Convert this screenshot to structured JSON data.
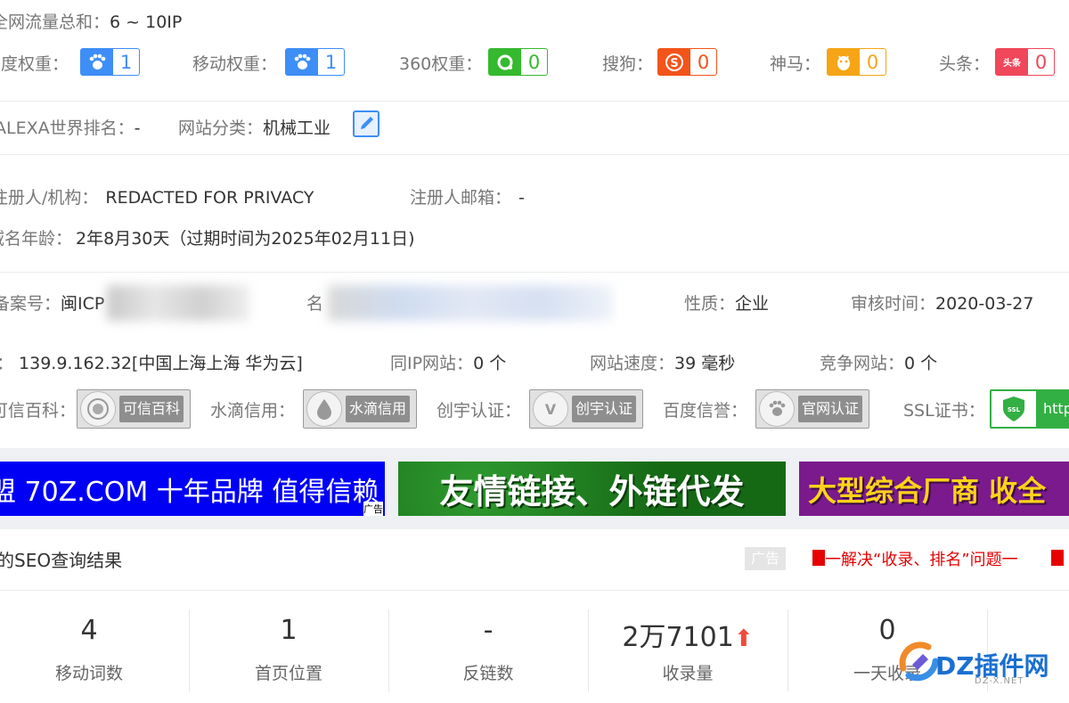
{
  "row1": {
    "label": "全网流量总和：",
    "value": "6 ~ 10IP"
  },
  "weights": [
    {
      "label": "百度权重：",
      "value": "1",
      "color": "#3e8ef7",
      "icon": "baidu-paw-icon"
    },
    {
      "label": "移动权重：",
      "value": "1",
      "color": "#3e8ef7",
      "icon": "baidu-mobile-icon"
    },
    {
      "label": "360权重：",
      "value": "0",
      "color": "#35b92f",
      "icon": "360-icon"
    },
    {
      "label": "搜狗：",
      "value": "0",
      "color": "#f2541b",
      "icon": "sogou-icon"
    },
    {
      "label": "神马：",
      "value": "0",
      "color": "#f5a516",
      "icon": "shenma-icon"
    },
    {
      "label": "头条：",
      "value": "0",
      "color": "#f0475a",
      "icon": "toutiao-icon",
      "icon_text": "头条"
    }
  ],
  "row3": {
    "alexa_label": "ALEXA世界排名：",
    "alexa_value": "-",
    "category_label": "网站分类：",
    "category_value": "机械工业"
  },
  "row4": {
    "registrant_label": "注册人/机构：",
    "registrant_value": "REDACTED FOR PRIVACY",
    "email_label": "注册人邮箱：",
    "email_value": "-"
  },
  "row5": {
    "age_label": "域名年龄：",
    "age_value": "2年8月30天（过期时间为2025年02月11日)"
  },
  "row6": {
    "icp_label": "备案号：",
    "icp_value": "闽ICP",
    "name_label": "名",
    "nature_label": "性质：",
    "nature_value": "企业",
    "audit_label": "审核时间：",
    "audit_value": "2020-03-27"
  },
  "row7": {
    "ip_label": "：",
    "ip_value": "139.9.162.32[中国上海上海 华为云]",
    "sameip_label": "同IP网站：",
    "sameip_value": "0 个",
    "speed_label": "网站速度：",
    "speed_value": "39 毫秒",
    "compete_label": "竞争网站：",
    "compete_value": "0 个"
  },
  "certs": [
    {
      "label": "可信百科：",
      "badge": "可信百科",
      "icon": "kexin-seal-icon"
    },
    {
      "label": "水滴信用：",
      "badge": "水滴信用",
      "icon": "water-drop-icon"
    },
    {
      "label": "创宇认证：",
      "badge": "创宇认证",
      "icon": "chuangyu-v-icon"
    },
    {
      "label": "百度信誉：",
      "badge": "官网认证",
      "icon": "baidu-paw-icon"
    },
    {
      "label": "SSL证书：",
      "badge": "http",
      "icon": "ssl-shield-icon"
    }
  ],
  "banners": [
    {
      "text": "盟 70Z.COM 十年品牌 值得信赖",
      "ad": "广告",
      "bg": "#0000f5",
      "fg": "#ffffff"
    },
    {
      "text": "友情链接、外链代发",
      "bg": "#1a7a1a",
      "fg": "#ffffff"
    },
    {
      "text": "大型综合厂商 收全",
      "bg": "#7a1a8c",
      "fg": "#ffd21a"
    }
  ],
  "seo": {
    "title": "的SEO查询结果",
    "ad_tag": "广告",
    "promo": "一解决“收录、排名”问题一"
  },
  "stats": [
    {
      "value": "4",
      "label": "移动词数"
    },
    {
      "value": "1",
      "label": "首页位置"
    },
    {
      "value": "-",
      "label": "反链数"
    },
    {
      "value": "2万7101",
      "label": "收录量",
      "trend": "up"
    },
    {
      "value": "0",
      "label": "一天收录"
    }
  ],
  "watermark": {
    "brand": "DZ插件网",
    "url": "DZ-X.NET"
  }
}
